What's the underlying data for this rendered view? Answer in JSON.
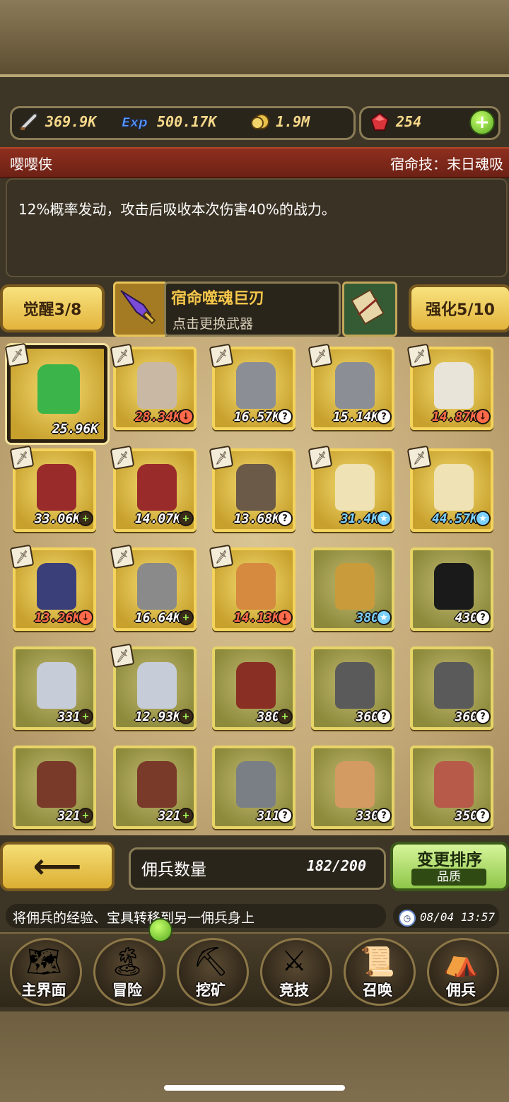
{
  "resources": {
    "attack": {
      "icon": "sword-icon",
      "value": "369.9K"
    },
    "exp": {
      "icon": "exp-icon",
      "value": "500.17K"
    },
    "gold": {
      "icon": "coin-icon",
      "value": "1.9M"
    },
    "gems": {
      "icon": "ruby-icon",
      "value": "254"
    },
    "add_symbol": "+"
  },
  "hero": {
    "name": "嘤嘤侠",
    "destiny_skill": "宿命技：末日魂吸",
    "description": "12%概率发动，攻击后吸收本次伤害40%的战力。"
  },
  "actions": {
    "awaken": "觉醒3/8",
    "weapon_name": "宿命噬魂巨刃",
    "weapon_hint": "点击更换武器",
    "enhance": "强化5/10"
  },
  "mercenaries": [
    {
      "power": "25.96K",
      "tag": "",
      "tag_symbol": "",
      "has_weapon": true,
      "color": "#3bb54a",
      "power_color": "white",
      "style": "selected"
    },
    {
      "power": "28.34K",
      "tag": "down",
      "tag_symbol": "↓",
      "has_weapon": true,
      "color": "#c9b9a4",
      "power_color": "red",
      "style": "gold"
    },
    {
      "power": "16.57K",
      "tag": "q",
      "tag_symbol": "?",
      "has_weapon": true,
      "color": "#8b8f95",
      "power_color": "white",
      "style": "gold"
    },
    {
      "power": "15.14K",
      "tag": "q",
      "tag_symbol": "?",
      "has_weapon": true,
      "color": "#8b8f95",
      "power_color": "white",
      "style": "gold"
    },
    {
      "power": "14.87K",
      "tag": "down",
      "tag_symbol": "↓",
      "has_weapon": true,
      "color": "#e9e4da",
      "power_color": "red",
      "style": "gold"
    },
    {
      "power": "33.06K",
      "tag": "plus",
      "tag_symbol": "+",
      "has_weapon": true,
      "color": "#9a2b2b",
      "power_color": "white",
      "style": "gold"
    },
    {
      "power": "14.07K",
      "tag": "plus",
      "tag_symbol": "+",
      "has_weapon": true,
      "color": "#9a2b2b",
      "power_color": "white",
      "style": "gold"
    },
    {
      "power": "13.68K",
      "tag": "q",
      "tag_symbol": "?",
      "has_weapon": true,
      "color": "#6b5a48",
      "power_color": "white",
      "style": "gold"
    },
    {
      "power": "31.4K",
      "tag": "star",
      "tag_symbol": "★",
      "has_weapon": true,
      "color": "#efe2b4",
      "power_color": "blue",
      "style": "gold"
    },
    {
      "power": "44.57K",
      "tag": "star",
      "tag_symbol": "★",
      "has_weapon": true,
      "color": "#efe2b4",
      "power_color": "blue",
      "style": "gold"
    },
    {
      "power": "13.26K",
      "tag": "down",
      "tag_symbol": "↓",
      "has_weapon": true,
      "color": "#3a3f7a",
      "power_color": "red",
      "style": "gold"
    },
    {
      "power": "16.64K",
      "tag": "plus",
      "tag_symbol": "+",
      "has_weapon": true,
      "color": "#8a8a8a",
      "power_color": "white",
      "style": "gold"
    },
    {
      "power": "14.13K",
      "tag": "down",
      "tag_symbol": "↓",
      "has_weapon": true,
      "color": "#d58a3f",
      "power_color": "red",
      "style": "gold"
    },
    {
      "power": "380",
      "tag": "star",
      "tag_symbol": "★",
      "has_weapon": false,
      "color": "#c99b3a",
      "power_color": "blue",
      "style": "green"
    },
    {
      "power": "430",
      "tag": "q",
      "tag_symbol": "?",
      "has_weapon": false,
      "color": "#1a1a1a",
      "power_color": "white",
      "style": "green"
    },
    {
      "power": "331",
      "tag": "plus",
      "tag_symbol": "+",
      "has_weapon": false,
      "color": "#c6ccd8",
      "power_color": "white",
      "style": "green"
    },
    {
      "power": "12.93K",
      "tag": "plus",
      "tag_symbol": "+",
      "has_weapon": true,
      "color": "#c6ccd8",
      "power_color": "white",
      "style": "green"
    },
    {
      "power": "380",
      "tag": "plus",
      "tag_symbol": "+",
      "has_weapon": false,
      "color": "#8a2f24",
      "power_color": "white",
      "style": "green"
    },
    {
      "power": "360",
      "tag": "q",
      "tag_symbol": "?",
      "has_weapon": false,
      "color": "#5a5a5a",
      "power_color": "white",
      "style": "green"
    },
    {
      "power": "360",
      "tag": "q",
      "tag_symbol": "?",
      "has_weapon": false,
      "color": "#5a5a5a",
      "power_color": "white",
      "style": "green"
    },
    {
      "power": "321",
      "tag": "plus",
      "tag_symbol": "+",
      "has_weapon": false,
      "color": "#7a3a2a",
      "power_color": "white",
      "style": "green"
    },
    {
      "power": "321",
      "tag": "plus",
      "tag_symbol": "+",
      "has_weapon": false,
      "color": "#7a3a2a",
      "power_color": "white",
      "style": "green"
    },
    {
      "power": "311",
      "tag": "q",
      "tag_symbol": "?",
      "has_weapon": false,
      "color": "#7a7f86",
      "power_color": "white",
      "style": "green"
    },
    {
      "power": "330",
      "tag": "q",
      "tag_symbol": "?",
      "has_weapon": false,
      "color": "#d39a62",
      "power_color": "white",
      "style": "green"
    },
    {
      "power": "350",
      "tag": "q",
      "tag_symbol": "?",
      "has_weapon": false,
      "color": "#b85a4a",
      "power_color": "white",
      "style": "green"
    }
  ],
  "controls": {
    "back_symbol": "⟵",
    "count_label": "佣兵数量",
    "count_value": "182/200",
    "sort_label": "变更排序",
    "sort_sub": "品质"
  },
  "tip": {
    "text": "将佣兵的经验、宝具转移到另一佣兵身上",
    "time": "08/04 13:57"
  },
  "nav": [
    {
      "label": "主界面",
      "icon": "map-scroll-icon",
      "glyph": "🗺"
    },
    {
      "label": "冒险",
      "icon": "island-icon",
      "glyph": "🏝"
    },
    {
      "label": "挖矿",
      "icon": "pickaxe-icon",
      "glyph": "⛏"
    },
    {
      "label": "竞技",
      "icon": "crossed-swords-icon",
      "glyph": "⚔"
    },
    {
      "label": "召唤",
      "icon": "summon-scroll-icon",
      "glyph": "📜"
    },
    {
      "label": "佣兵",
      "icon": "tent-icon",
      "glyph": "⛺"
    }
  ]
}
